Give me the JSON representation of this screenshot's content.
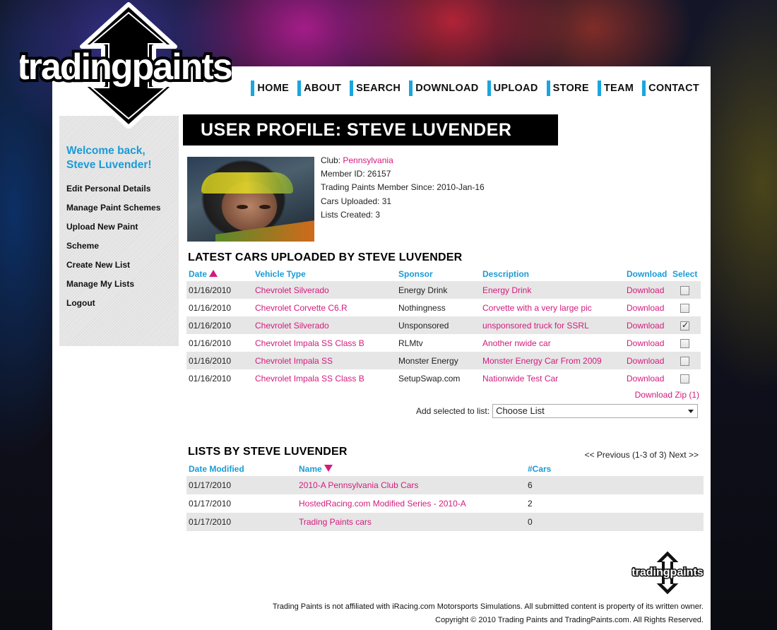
{
  "brand": {
    "logo_text": "tradingpaints",
    "accent": "#19a6df",
    "link_color": "#d31b7d"
  },
  "nav": [
    "HOME",
    "ABOUT",
    "SEARCH",
    "DOWNLOAD",
    "UPLOAD",
    "STORE",
    "TEAM",
    "CONTACT"
  ],
  "sidebar": {
    "welcome_line1": "Welcome back,",
    "welcome_line2": "Steve Luvender!",
    "links": [
      "Edit Personal Details",
      "Manage Paint Schemes",
      "Upload New Paint Scheme",
      "Create New List",
      "Manage My Lists",
      "Logout"
    ]
  },
  "profile": {
    "title": "USER PROFILE: STEVE LUVENDER",
    "club_label": "Club:",
    "club": "Pennsylvania",
    "member_id": "Member ID: 26157",
    "member_since": "Trading Paints Member Since: 2010-Jan-16",
    "cars_uploaded": "Cars Uploaded: 31",
    "lists_created": "Lists Created: 3"
  },
  "cars_section": {
    "title": "LATEST CARS UPLOADED BY STEVE LUVENDER",
    "headers": [
      "Date",
      "Vehicle Type",
      "Sponsor",
      "Description",
      "Download",
      "Select"
    ],
    "rows": [
      {
        "date": "01/16/2010",
        "vehicle": "Chevrolet Silverado",
        "sponsor": "Energy Drink",
        "description": "Energy Drink",
        "download": "Download",
        "selected": false
      },
      {
        "date": "01/16/2010",
        "vehicle": "Chevrolet Corvette C6.R",
        "sponsor": "Nothingness",
        "description": "Corvette with a very large pic",
        "download": "Download",
        "selected": false
      },
      {
        "date": "01/16/2010",
        "vehicle": "Chevrolet Silverado",
        "sponsor": "Unsponsored",
        "description": "unsponsored truck for SSRL",
        "download": "Download",
        "selected": true
      },
      {
        "date": "01/16/2010",
        "vehicle": "Chevrolet Impala SS Class B",
        "sponsor": "RLMtv",
        "description": "Another nwide car",
        "download": "Download",
        "selected": false
      },
      {
        "date": "01/16/2010",
        "vehicle": "Chevrolet Impala SS",
        "sponsor": "Monster Energy",
        "description": "Monster Energy Car From 2009",
        "download": "Download",
        "selected": false
      },
      {
        "date": "01/16/2010",
        "vehicle": "Chevrolet Impala SS Class B",
        "sponsor": "SetupSwap.com",
        "description": "Nationwide Test Car",
        "download": "Download",
        "selected": false
      }
    ],
    "download_zip": "Download Zip (1)",
    "add_selected_label": "Add selected to list:",
    "choose_list": "Choose List"
  },
  "lists_section": {
    "title": "LISTS BY STEVE LUVENDER",
    "pager": "<< Previous (1-3 of 3) Next >>",
    "headers": [
      "Date Modified",
      "Name",
      "#Cars"
    ],
    "rows": [
      {
        "date": "01/17/2010",
        "name": "2010-A Pennsylvania Club Cars",
        "cars": "6"
      },
      {
        "date": "01/17/2010",
        "name": "HostedRacing.com Modified Series - 2010-A",
        "cars": "2"
      },
      {
        "date": "01/17/2010",
        "name": "Trading Paints cars",
        "cars": "0"
      }
    ]
  },
  "footer": {
    "logo_text": "tradingpaints",
    "disclaimer": "Trading Paints is not affiliated with iRacing.com Motorsports Simulations. All submitted content is property of its written owner.",
    "copyright": "Copyright © 2010 Trading Paints and TradingPaints.com. All Rights Reserved."
  }
}
